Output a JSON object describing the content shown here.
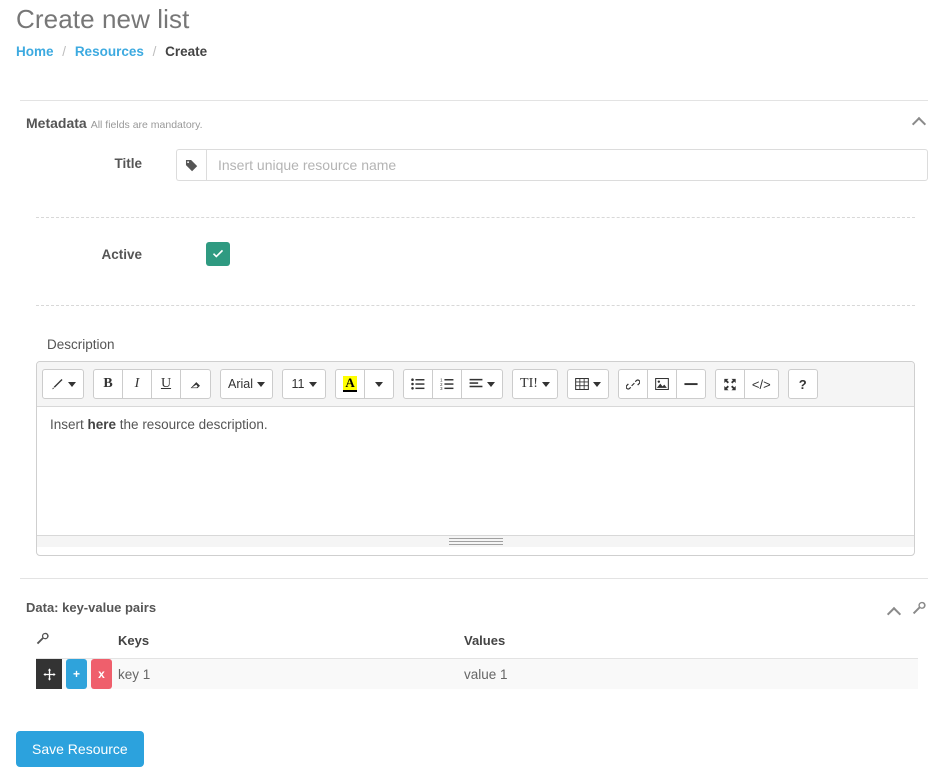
{
  "header": {
    "title": "Create new list",
    "breadcrumb": [
      {
        "label": "Home",
        "link": true
      },
      {
        "label": "Resources",
        "link": true
      },
      {
        "label": "Create",
        "link": false
      }
    ],
    "separator": "/"
  },
  "metadata": {
    "heading": "Metadata",
    "subtext": "All fields are mandatory.",
    "collapse_icon": "chevron-up-icon",
    "title_field": {
      "label": "Title",
      "placeholder": "Insert unique resource name",
      "value": "",
      "addon_icon": "tag-icon"
    },
    "active_field": {
      "label": "Active",
      "checked": true,
      "check_icon": "check-icon",
      "color": "#2f9a81"
    }
  },
  "description": {
    "label": "Description",
    "content_prefix": "Insert ",
    "content_bold": "here",
    "content_suffix": " the resource description.",
    "toolbar": {
      "style_icon": "magic-wand-icon",
      "bold": "B",
      "italic": "I",
      "underline": "U",
      "clear_icon": "eraser-icon",
      "fontname": "Arial",
      "fontsize": "11",
      "highlight_letter": "A",
      "highlight_color": "#ffff00",
      "ul_icon": "unordered-list-icon",
      "ol_icon": "ordered-list-icon",
      "paragraph_icon": "align-left-icon",
      "lineheight_label": "TI!",
      "table_icon": "table-icon",
      "link_icon": "link-icon",
      "picture_icon": "picture-icon",
      "hr_icon": "horizontal-rule-icon",
      "fullscreen_icon": "fullscreen-icon",
      "codeview_label": "</>",
      "help_label": "?"
    },
    "resize_handle": "resize-grip-icon"
  },
  "data_section": {
    "heading": "Data: key-value pairs",
    "collapse_icon": "chevron-up-icon",
    "settings_icon": "wrench-icon",
    "table": {
      "tools_header_icon": "wrench-icon",
      "columns": [
        "Keys",
        "Values"
      ],
      "rows": [
        {
          "move_icon": "move-handle-icon",
          "add_label": "+",
          "remove_label": "x",
          "key": "key 1",
          "value": "value 1"
        }
      ]
    }
  },
  "footer": {
    "save_label": "Save Resource",
    "save_color": "#2ca2dd"
  }
}
